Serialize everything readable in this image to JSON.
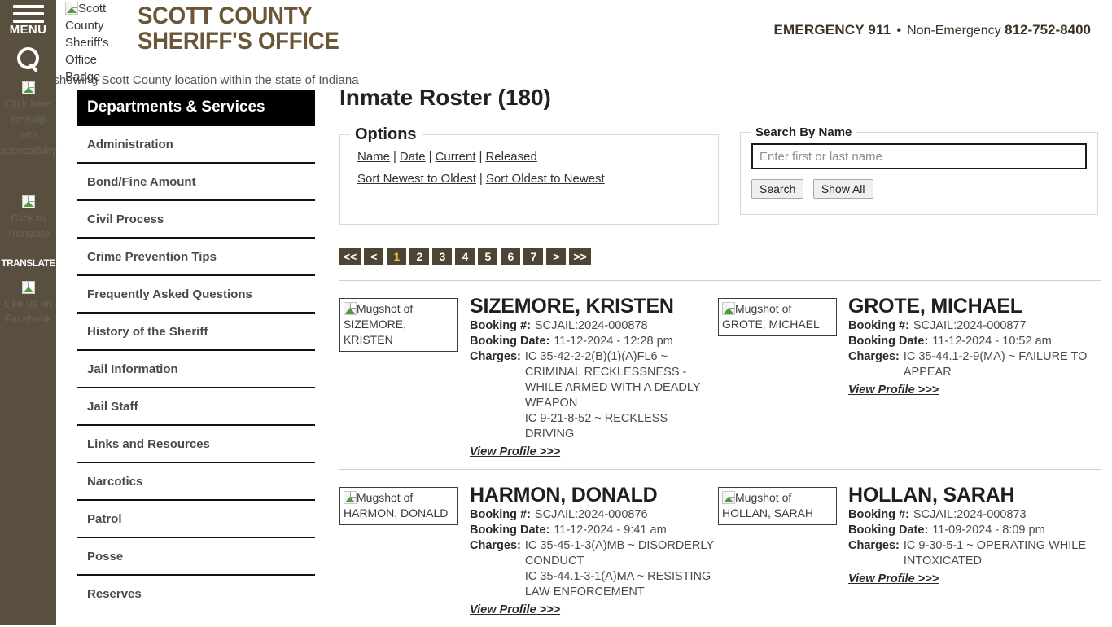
{
  "rail": {
    "menu_label": "MENU",
    "translate_word": "TRANSLATE",
    "items": [
      {
        "name": "accessibility",
        "alt": "Click here for help with accessibility"
      },
      {
        "name": "translate",
        "alt": "Click to Translate"
      },
      {
        "name": "facebook",
        "alt": "Like us on Facebook"
      }
    ]
  },
  "header": {
    "badge_alt": "Scott County Sheriff's Office Badge",
    "title_line1": "SCOTT COUNTY",
    "title_line2": "SHERIFF'S OFFICE",
    "emergency_label": "EMERGENCY 911",
    "separator": "•",
    "non_emergency_label": "Non-Emergency",
    "non_emergency_phone": "812-752-8400"
  },
  "hero": {
    "map_alt": "Map showing Scott County location within the state of Indiana"
  },
  "sidenav": {
    "header": "Departments & Services",
    "items": [
      {
        "label": "Administration"
      },
      {
        "label": "Bond/Fine Amount"
      },
      {
        "label": "Civil Process"
      },
      {
        "label": "Crime Prevention Tips"
      },
      {
        "label": "Frequently Asked Questions"
      },
      {
        "label": "History of the Sheriff"
      },
      {
        "label": "Jail Information"
      },
      {
        "label": "Jail Staff"
      },
      {
        "label": "Links and Resources"
      },
      {
        "label": "Narcotics"
      },
      {
        "label": "Patrol"
      },
      {
        "label": "Posse"
      },
      {
        "label": "Reserves"
      }
    ]
  },
  "main": {
    "page_title": "Inmate Roster (180)",
    "options": {
      "legend": "Options",
      "filters": [
        "Name",
        "Date",
        "Current",
        "Released"
      ],
      "sorts": [
        "Sort Newest to Oldest",
        "Sort Oldest to Newest"
      ],
      "separator": "|"
    },
    "search": {
      "legend": "Search By Name",
      "placeholder": "Enter first or last name",
      "value": "",
      "search_label": "Search",
      "show_all_label": "Show All"
    },
    "pagination": {
      "items": [
        "<<",
        "<",
        "1",
        "2",
        "3",
        "4",
        "5",
        "6",
        "7",
        ">",
        ">>"
      ],
      "current": "1",
      "current_color": "#e8c140",
      "background": "#4d4434"
    },
    "labels": {
      "booking_number": "Booking #:",
      "booking_date": "Booking Date:",
      "charges": "Charges:",
      "view_profile": "View Profile >>>"
    },
    "inmates": [
      {
        "name": "SIZEMORE, KRISTEN",
        "mug_alt": "Mugshot of SIZEMORE, KRISTEN",
        "booking_number": "SCJAIL:2024-000878",
        "booking_date": "11-12-2024 - 12:28 pm",
        "charges": [
          "IC 35-42-2-2(B)(1)(A)FL6 ~ CRIMINAL RECKLESSNESS - WHILE ARMED WITH A DEADLY WEAPON",
          "IC 9-21-8-52 ~ RECKLESS DRIVING"
        ]
      },
      {
        "name": "GROTE, MICHAEL",
        "mug_alt": "Mugshot of GROTE, MICHAEL",
        "booking_number": "SCJAIL:2024-000877",
        "booking_date": "11-12-2024 - 10:52 am",
        "charges": [
          "IC 35-44.1-2-9(MA) ~ FAILURE TO APPEAR"
        ]
      },
      {
        "name": "HARMON, DONALD",
        "mug_alt": "Mugshot of HARMON, DONALD",
        "booking_number": "SCJAIL:2024-000876",
        "booking_date": "11-12-2024 - 9:41 am",
        "charges": [
          "IC 35-45-1-3(A)MB ~ DISORDERLY CONDUCT",
          "IC 35-44.1-3-1(A)MA ~ RESISTING LAW ENFORCEMENT"
        ]
      },
      {
        "name": "HOLLAN, SARAH",
        "mug_alt": "Mugshot of HOLLAN, SARAH",
        "booking_number": "SCJAIL:2024-000873",
        "booking_date": "11-09-2024 - 8:09 pm",
        "charges": [
          "IC 9-30-5-1 ~ OPERATING WHILE INTOXICATED"
        ]
      }
    ]
  },
  "colors": {
    "rail": "#584f3f",
    "brand_brown": "#6b5638",
    "nav_header": "#000000"
  }
}
